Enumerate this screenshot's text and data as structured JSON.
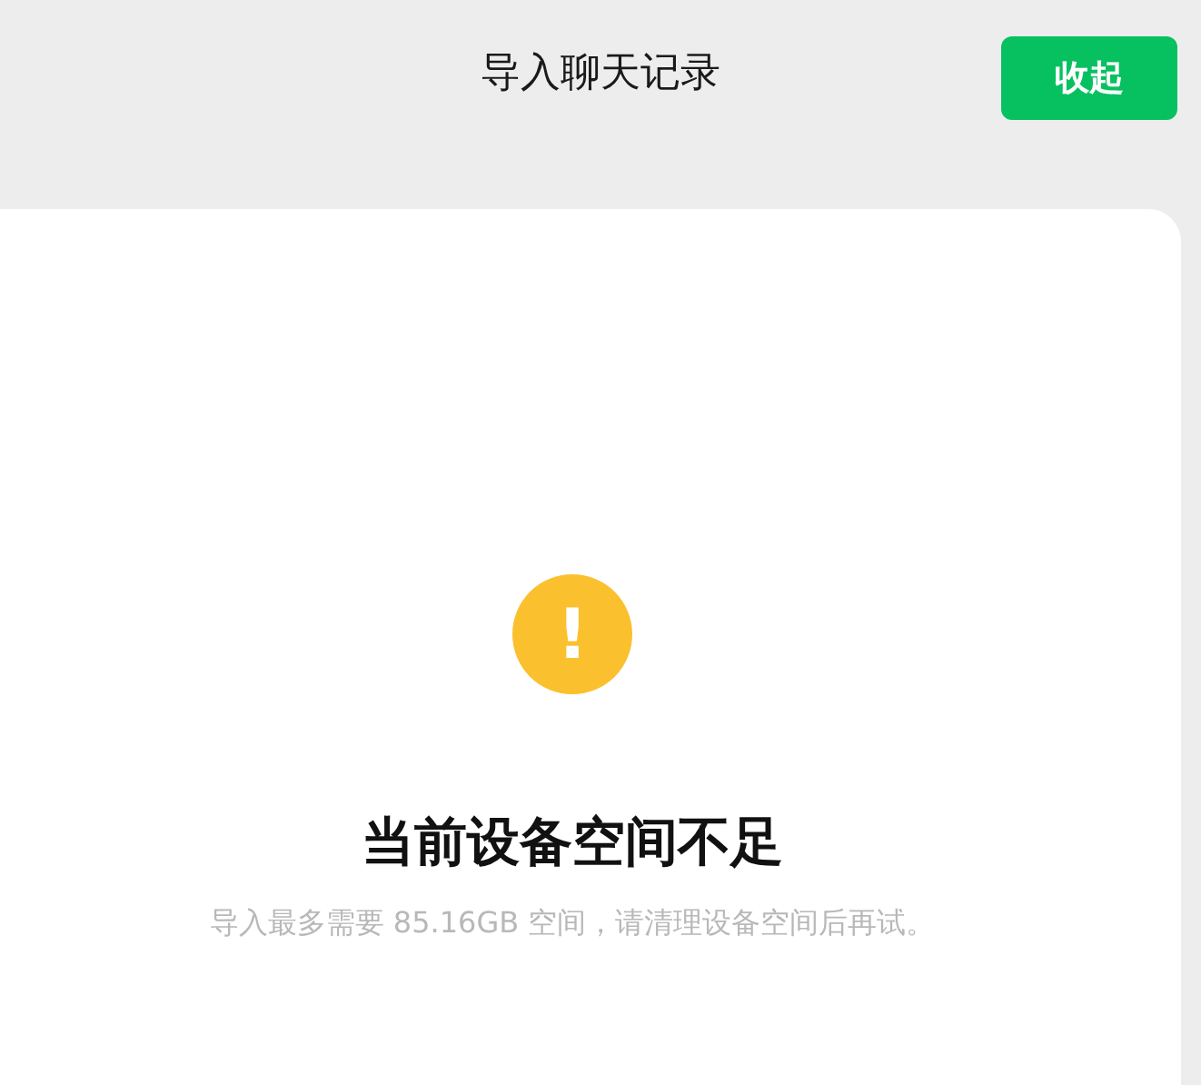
{
  "header": {
    "title": "导入聊天记录",
    "button": "收起"
  },
  "notice": {
    "icon": "!",
    "title": "当前设备空间不足",
    "message": "导入最多需要 85.16GB 空间，请清理设备空间后再试。"
  }
}
